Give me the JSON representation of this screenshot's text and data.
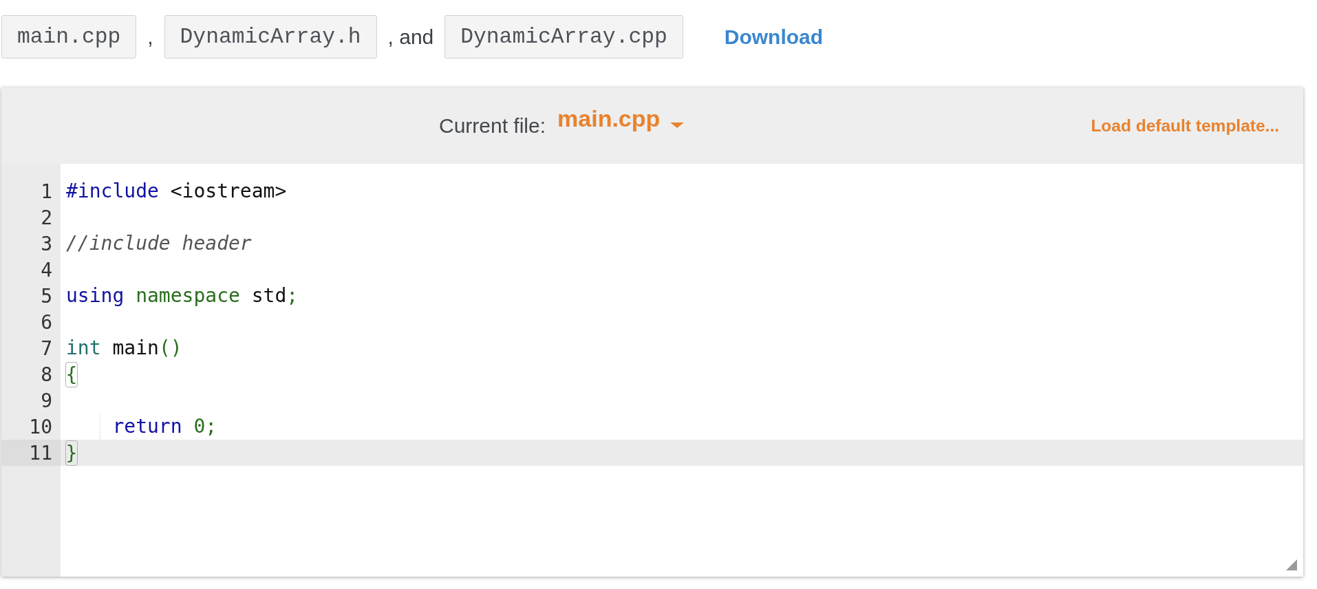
{
  "file_list": [
    {
      "kind": "file",
      "text": "main.cpp"
    },
    {
      "kind": "separator",
      "text": ","
    },
    {
      "kind": "file",
      "text": "DynamicArray.h"
    },
    {
      "kind": "separator",
      "text": ", and"
    },
    {
      "kind": "file",
      "text": "DynamicArray.cpp"
    }
  ],
  "download_link": "Download",
  "editor": {
    "current_file_label": "Current file:",
    "current_file": "main.cpp",
    "load_template_link": "Load default template...",
    "lines": [
      {
        "number": "1",
        "active": false,
        "indent_guide": false,
        "tokens": [
          {
            "kind": "keyword",
            "text": "#include",
            "matched": false
          },
          {
            "kind": "text",
            "text": " <iostream>",
            "matched": false
          }
        ]
      },
      {
        "number": "2",
        "active": false,
        "indent_guide": false
      },
      {
        "number": "3",
        "active": false,
        "indent_guide": false,
        "tokens": [
          {
            "kind": "comment",
            "text": "//include header",
            "matched": false
          }
        ]
      },
      {
        "number": "4",
        "active": false,
        "indent_guide": false
      },
      {
        "number": "5",
        "active": false,
        "indent_guide": false,
        "tokens": [
          {
            "kind": "keyword",
            "text": "using",
            "matched": false
          },
          {
            "kind": "builtin",
            "text": " namespace",
            "matched": false
          },
          {
            "kind": "text",
            "text": " std",
            "matched": false
          },
          {
            "kind": "punct",
            "text": ";",
            "matched": false
          }
        ]
      },
      {
        "number": "6",
        "active": false,
        "indent_guide": false
      },
      {
        "number": "7",
        "active": false,
        "indent_guide": false,
        "tokens": [
          {
            "kind": "type",
            "text": "int",
            "matched": false
          },
          {
            "kind": "text",
            "text": " main",
            "matched": false
          },
          {
            "kind": "punct",
            "text": "()",
            "matched": false
          }
        ]
      },
      {
        "number": "8",
        "active": false,
        "indent_guide": false,
        "tokens": [
          {
            "kind": "punct",
            "text": "{",
            "matched": true
          }
        ]
      },
      {
        "number": "9",
        "active": false,
        "indent_guide": false
      },
      {
        "number": "10",
        "active": false,
        "indent_guide": true,
        "tokens": [
          {
            "kind": "keyword",
            "text": "    return",
            "matched": false
          },
          {
            "kind": "number",
            "text": " 0",
            "matched": false
          },
          {
            "kind": "punct",
            "text": ";",
            "matched": false
          }
        ]
      },
      {
        "number": "11",
        "active": true,
        "indent_guide": false,
        "tokens": [
          {
            "kind": "punct",
            "text": "}",
            "matched": true
          }
        ]
      }
    ]
  }
}
